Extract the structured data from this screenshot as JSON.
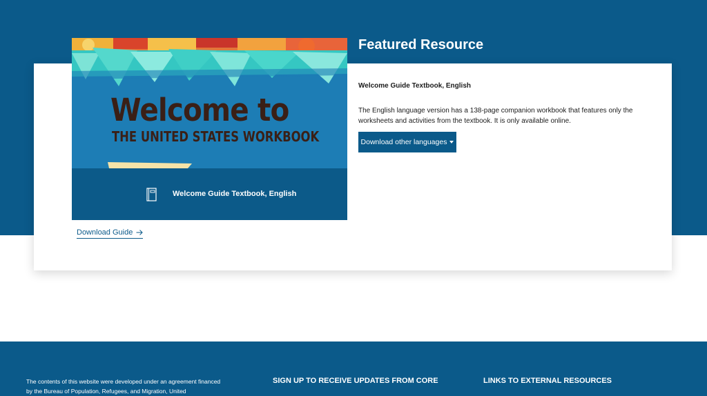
{
  "featured": {
    "heading": "Featured Resource",
    "cover": {
      "title_line1": "Welcome to",
      "title_line2": "THE UNITED STATES WORKBOOK",
      "caption": "Welcome Guide Textbook, English"
    },
    "download_link": "Download Guide",
    "title": "Welcome Guide Textbook, English",
    "description": "The English language version has a 138-page companion workbook that features only the worksheets and activities from the textbook. It is only available online.",
    "languages_button": "Download other languages"
  },
  "footer": {
    "funding_text": "The contents of this website were developed under an agreement financed by the Bureau of Population, Refugees, and Migration, United",
    "signup_heading": "SIGN UP TO RECEIVE UPDATES FROM CORE",
    "links_heading": "LINKS TO EXTERNAL RESOURCES"
  },
  "colors": {
    "brand_blue": "#0b5a8a",
    "cover_blue": "#1a7ab2",
    "card_bg": "#ffffff"
  },
  "icons": [
    "book-icon",
    "arrow-right-icon",
    "caret-down-icon"
  ]
}
